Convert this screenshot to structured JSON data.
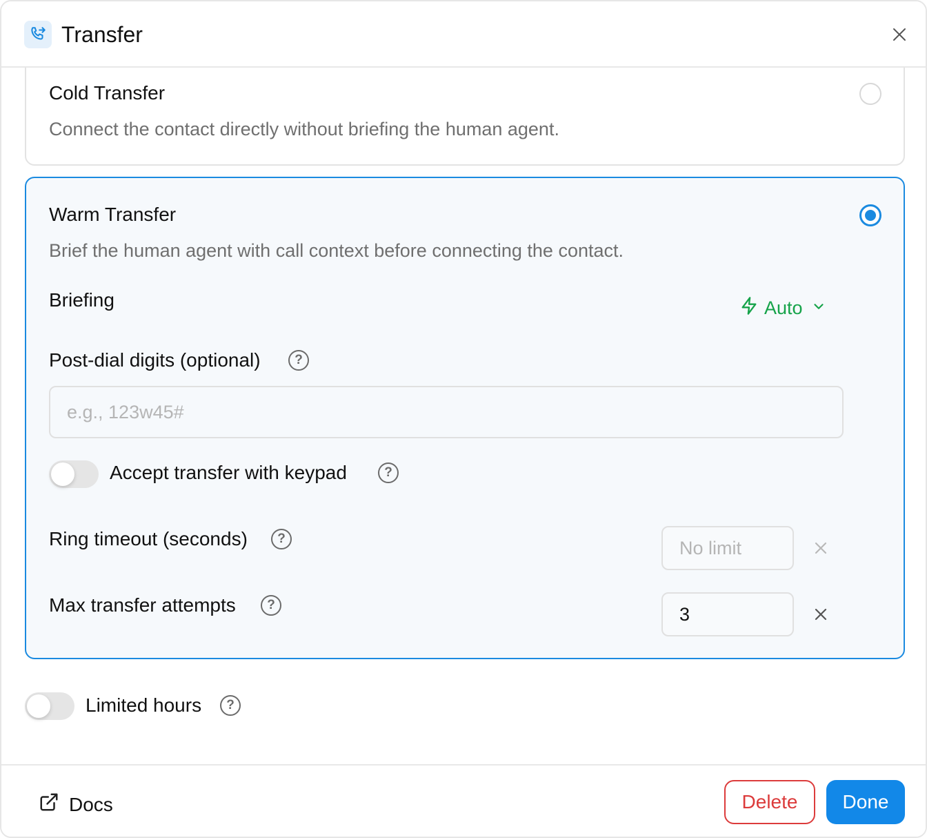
{
  "header": {
    "title": "Transfer",
    "icon": "phone-transfer-icon"
  },
  "cold": {
    "title": "Cold Transfer",
    "description": "Connect the contact directly without briefing the human agent.",
    "selected": false
  },
  "warm": {
    "title": "Warm Transfer",
    "description": "Brief the human agent with call context before connecting the contact.",
    "selected": true,
    "briefing": {
      "label": "Briefing",
      "mode": "Auto",
      "icon": "lightning-icon"
    },
    "post_dial": {
      "label": "Post-dial digits (optional)",
      "placeholder": "e.g., 123w45#",
      "value": ""
    },
    "keypad": {
      "label": "Accept transfer with keypad",
      "enabled": false
    },
    "ring_timeout": {
      "label": "Ring timeout (seconds)",
      "placeholder": "No limit",
      "value": ""
    },
    "max_attempts": {
      "label": "Max transfer attempts",
      "value": "3"
    }
  },
  "limited_hours": {
    "label": "Limited hours",
    "enabled": false
  },
  "footer": {
    "docs_label": "Docs",
    "delete_label": "Delete",
    "done_label": "Done"
  },
  "colors": {
    "accent": "#1a8ae0",
    "success": "#16a34a",
    "danger": "#dc3b3b",
    "primary_button": "#1288e8"
  }
}
